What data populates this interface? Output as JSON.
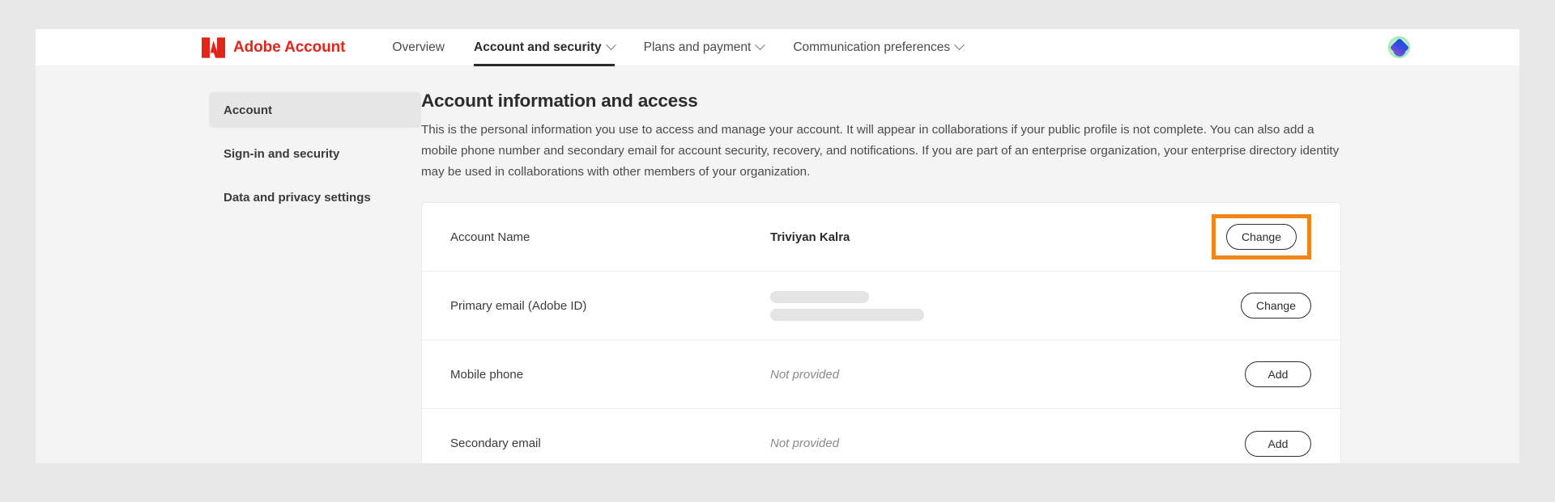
{
  "header": {
    "brand_text": "Adobe Account",
    "logo_icon": "adobe-logo-icon",
    "nav_items": [
      {
        "label": "Overview",
        "has_caret": false,
        "active": false
      },
      {
        "label": "Account and security",
        "has_caret": true,
        "active": true
      },
      {
        "label": "Plans and payment",
        "has_caret": true,
        "active": false
      },
      {
        "label": "Communication preferences",
        "has_caret": true,
        "active": false
      }
    ],
    "avatar_icon": "user-avatar-icon"
  },
  "sidebar": {
    "items": [
      {
        "label": "Account",
        "selected": true
      },
      {
        "label": "Sign-in and security",
        "selected": false
      },
      {
        "label": "Data and privacy settings",
        "selected": false
      }
    ]
  },
  "main": {
    "title": "Account information and access",
    "description": "This is the personal information you use to access and manage your account. It will appear in collaborations if your public profile is not complete. You can also add a mobile phone number and secondary email for account security, recovery, and notifications. If you are part of an enterprise organization, your enterprise directory identity may be used in collaborations with other members of your organization.",
    "rows": [
      {
        "label": "Account Name",
        "value": "Triviyan Kalra",
        "value_type": "text",
        "action_label": "Change",
        "highlighted": true
      },
      {
        "label": "Primary email (Adobe ID)",
        "value": "",
        "value_type": "redacted",
        "redacted_widths": [
          122,
          190
        ],
        "action_label": "Change",
        "highlighted": false
      },
      {
        "label": "Mobile phone",
        "value": "Not provided",
        "value_type": "muted",
        "action_label": "Add",
        "highlighted": false
      },
      {
        "label": "Secondary email",
        "value": "Not provided",
        "value_type": "muted",
        "action_label": "Add",
        "highlighted": false
      }
    ]
  },
  "colors": {
    "adobe_red": "#e1251b",
    "highlight_orange": "#f0851a",
    "page_background": "#e8e8e8",
    "content_background": "#f4f4f4",
    "card_background": "#ffffff",
    "text_primary": "#2c2c2c",
    "text_secondary": "#4b4b4b",
    "muted_text": "#8a8a8a"
  }
}
